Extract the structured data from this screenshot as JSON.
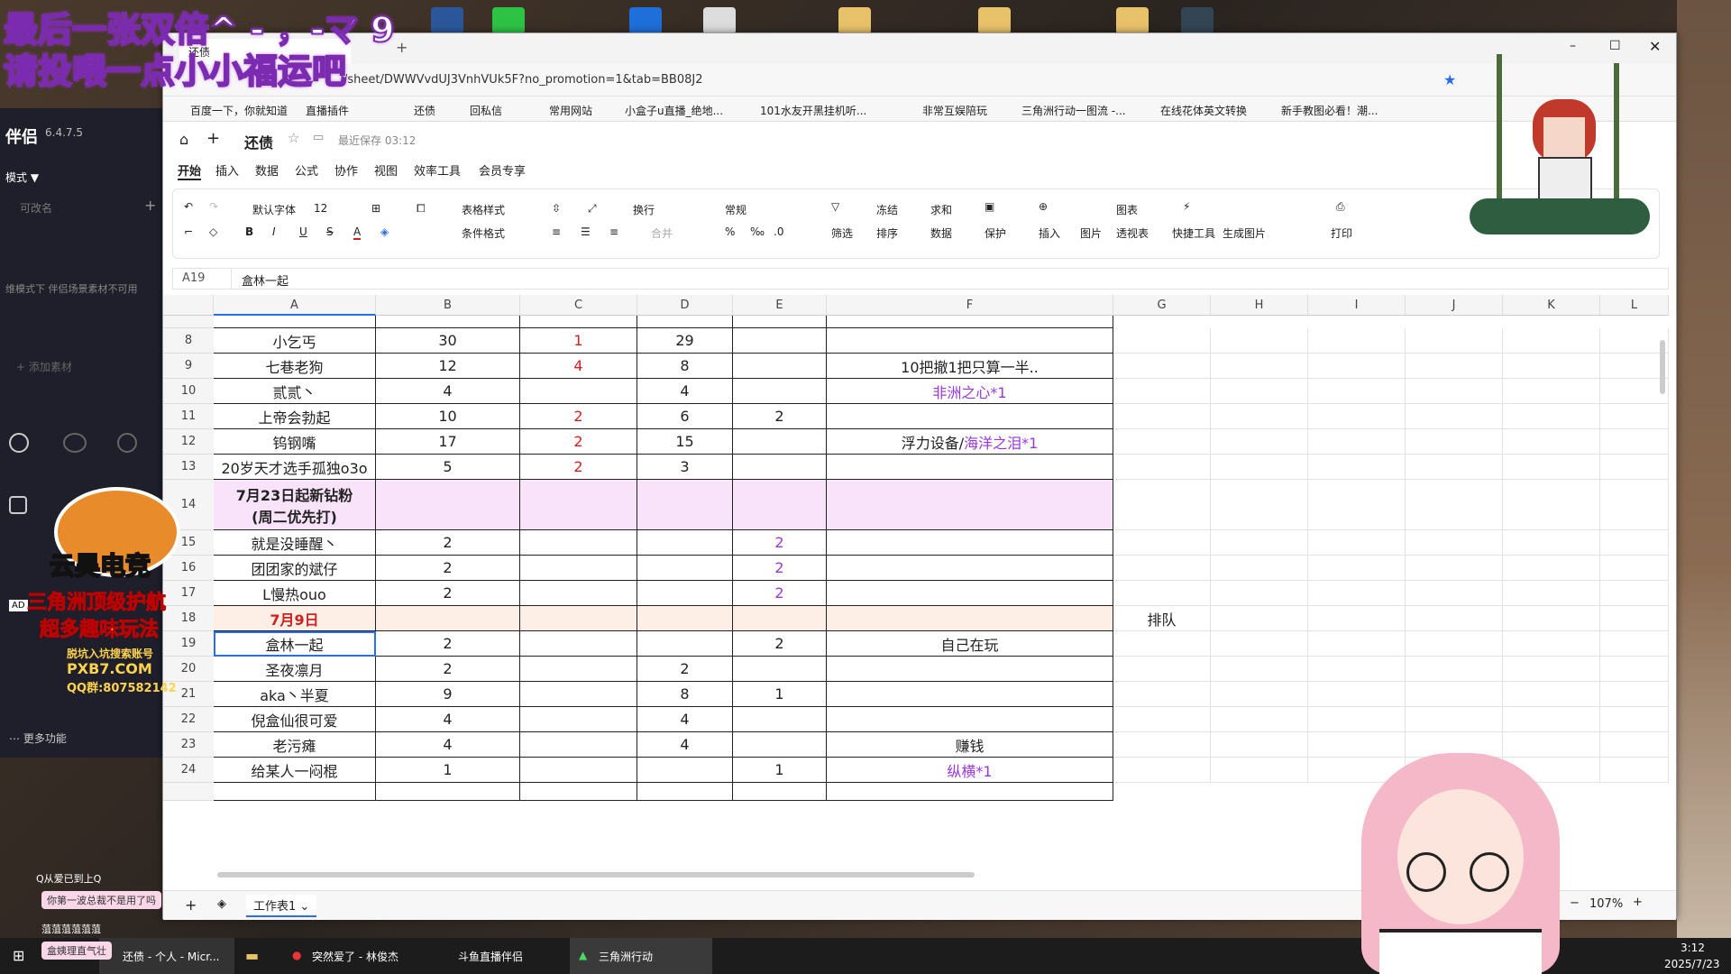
{
  "overlay": {
    "line1": "最后一张双倍^ - ，-マ 9",
    "line2": "请投喂一点小小福运吧"
  },
  "window": {
    "tab_title": "还债",
    "url": "/sheet/DWWVvdUJ3VnhVUk5F?no_promotion=1&tab=BB08J2"
  },
  "bookmarks": [
    "百度一下，你就知道",
    "直播插件",
    "还债",
    "回私信",
    "常用网站",
    "小盒子u直播_绝地...",
    "101水友开黑挂机听...",
    "非常互娱陪玩",
    "三角洲行动一图流 -...",
    "在线花体英文转换",
    "新手教图必看！潮..."
  ],
  "doc": {
    "title": "还债",
    "saved": "最近保存 03:12"
  },
  "menus": [
    "开始",
    "插入",
    "数据",
    "公式",
    "协作",
    "视图",
    "效率工具",
    "会员专享"
  ],
  "ribbon": {
    "font": "默认字体",
    "size": "12",
    "table_style": "表格样式",
    "cond_format": "条件格式",
    "wrap": "换行",
    "merge": "合并",
    "number_format": "常规",
    "filter": "筛选",
    "freeze": "冻结",
    "sort": "排序",
    "sum": "求和",
    "data": "数据",
    "protect": "保护",
    "insert": "插入",
    "image": "图片",
    "chart": "图表",
    "pivot": "透视表",
    "quick_tools": "快捷工具",
    "gen_image": "生成图片",
    "print": "打印"
  },
  "formula": {
    "cell_ref": "A19",
    "value": "盒林一起"
  },
  "columns": [
    "A",
    "B",
    "C",
    "D",
    "E",
    "F",
    "G",
    "H",
    "I",
    "J",
    "K",
    "L"
  ],
  "rows": [
    {
      "n": "8",
      "a": "小乞丐",
      "b": "30",
      "c": "1",
      "d": "29",
      "e": "",
      "f": "",
      "g": ""
    },
    {
      "n": "9",
      "a": "七巷老狗",
      "b": "12",
      "c": "4",
      "d": "8",
      "e": "",
      "f": "10把撤1把只算一半..",
      "g": ""
    },
    {
      "n": "10",
      "a": "贰贰丶",
      "b": "4",
      "c": "",
      "d": "4",
      "e": "",
      "f": "非洲之心*1",
      "g": ""
    },
    {
      "n": "11",
      "a": "上帝会勃起",
      "b": "10",
      "c": "2",
      "d": "6",
      "e": "2",
      "f": "",
      "g": ""
    },
    {
      "n": "12",
      "a": "钨钢嘴",
      "b": "17",
      "c": "2",
      "d": "15",
      "e": "",
      "f": "浮力设备/",
      "f2": "海洋之泪*1",
      "g": ""
    },
    {
      "n": "13",
      "a": "20岁天才选手孤独o3o",
      "b": "5",
      "c": "2",
      "d": "3",
      "e": "",
      "f": "",
      "g": ""
    },
    {
      "n": "14",
      "a": "7月23日起新钻粉",
      "a2": "(周二优先打)",
      "b": "",
      "c": "",
      "d": "",
      "e": "",
      "f": "",
      "g": ""
    },
    {
      "n": "15",
      "a": "就是没睡醒丶",
      "b": "2",
      "c": "",
      "d": "",
      "e": "2",
      "f": "",
      "g": ""
    },
    {
      "n": "16",
      "a": "团团家的斌仔",
      "b": "2",
      "c": "",
      "d": "",
      "e": "2",
      "f": "",
      "g": ""
    },
    {
      "n": "17",
      "a": "L慢热ouo",
      "b": "2",
      "c": "",
      "d": "",
      "e": "2",
      "f": "",
      "g": ""
    },
    {
      "n": "18",
      "a": "7月9日",
      "b": "",
      "c": "",
      "d": "",
      "e": "",
      "f": "",
      "g": "排队"
    },
    {
      "n": "19",
      "a": "盒林一起",
      "b": "2",
      "c": "",
      "d": "",
      "e": "2",
      "f": "自己在玩",
      "g": ""
    },
    {
      "n": "20",
      "a": "圣夜凛月",
      "b": "2",
      "c": "",
      "d": "2",
      "e": "",
      "f": "",
      "g": ""
    },
    {
      "n": "21",
      "a": "aka丶半夏",
      "b": "9",
      "c": "",
      "d": "8",
      "e": "1",
      "f": "",
      "g": ""
    },
    {
      "n": "22",
      "a": "倪盒仙很可爱",
      "b": "4",
      "c": "",
      "d": "4",
      "e": "",
      "f": "",
      "g": ""
    },
    {
      "n": "23",
      "a": "老污瘫",
      "b": "4",
      "c": "",
      "d": "4",
      "e": "",
      "f": "赚钱",
      "g": ""
    },
    {
      "n": "24",
      "a": "给某人一闷棍",
      "b": "1",
      "c": "",
      "d": "",
      "e": "1",
      "f": "纵横*1",
      "g": ""
    }
  ],
  "sheet_tab": "工作表1",
  "zoom": "107%",
  "left_panel": {
    "version": "6.4.7.5",
    "mode": "模式",
    "rename": "可改名",
    "hint": "维模式下 伴侣场景素材不可用",
    "add": "+ 添加素材",
    "more": "更多功能"
  },
  "stream_overlay": {
    "brand": "云昊电竞",
    "slogan1": "三角洲顶级护航",
    "slogan2": "超多趣味玩法",
    "footer": "脱坑入坑搜索账号",
    "code": "PXB7.COM",
    "qq": "QQ群:807582142"
  },
  "chat": [
    {
      "user": "Q从爱已到上Q",
      "msg": "你第一波总裁不是用了吗"
    },
    {
      "user": "菹菹菹菹菹菹",
      "msg": "盒姨理直气壮"
    }
  ],
  "taskbar": {
    "apps": [
      "还债 - 个人 - Micr...",
      "突然爱了 - 林俊杰",
      "斗鱼直播伴侣",
      "三角洲行动"
    ],
    "time": "3:12",
    "date": "2025/7/23"
  }
}
